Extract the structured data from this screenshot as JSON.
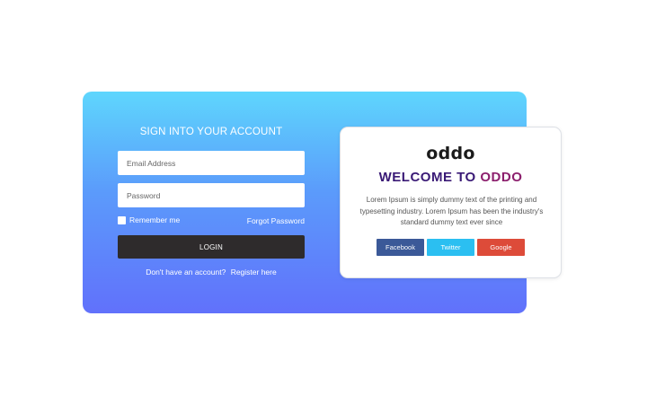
{
  "login": {
    "title": "SIGN INTO YOUR ACCOUNT",
    "email_placeholder": "Email Address",
    "password_placeholder": "Password",
    "remember_label": "Remember me",
    "forgot_link": "Forgot Password",
    "login_button": "LOGIN",
    "register_prompt": "Don't have an account?",
    "register_link": "Register here"
  },
  "welcome": {
    "logo": "oddo",
    "heading_part1": "WELCOME TO",
    "heading_part2": "ODDO",
    "body": "Lorem Ipsum is simply dummy text of the printing and typesetting industry. Lorem Ipsum has been the industry's standard dummy text ever since",
    "social": {
      "facebook": "Facebook",
      "twitter": "Twitter",
      "google": "Google"
    }
  },
  "colors": {
    "gradient_top": "#5ed6fd",
    "gradient_bottom": "#6171fb",
    "login_button": "#2e2b2c",
    "facebook": "#3b5998",
    "twitter": "#2bbff1",
    "google": "#dd4b39",
    "heading_primary": "#3a1a76",
    "heading_accent": "#8c1f6d"
  }
}
